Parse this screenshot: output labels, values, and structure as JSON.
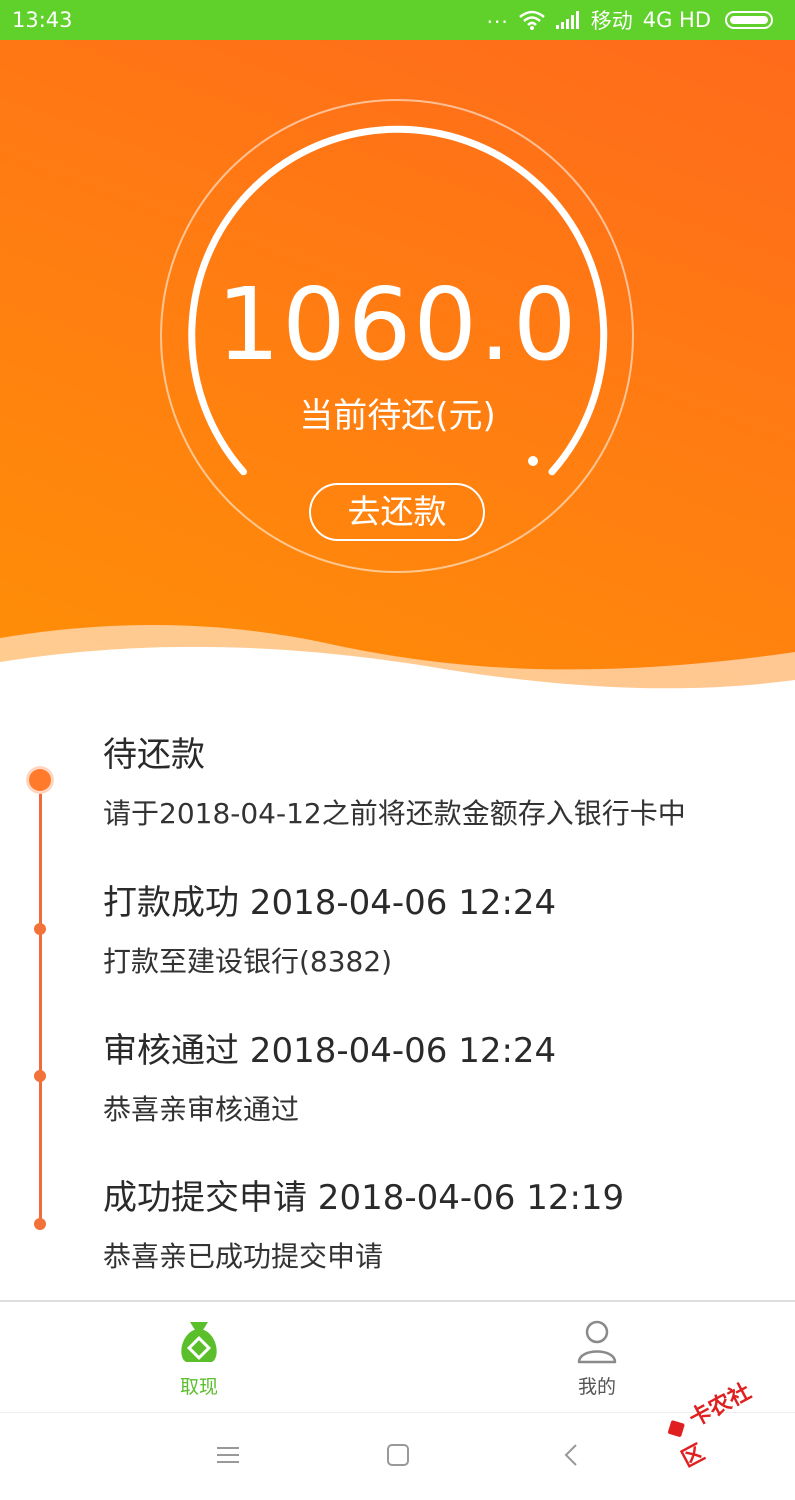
{
  "status_bar": {
    "time": "13:43",
    "dots": "...",
    "carrier": "移动",
    "network": "4G HD",
    "icons": [
      "wifi-icon",
      "signal-icon",
      "battery-icon"
    ]
  },
  "hero": {
    "amount": "1060.0",
    "amount_label": "当前待还(元)",
    "repay_button": "去还款"
  },
  "timeline": [
    {
      "title": "待还款",
      "desc": "请于2018-04-12之前将还款金额存入银行卡中"
    },
    {
      "title": "打款成功 2018-04-06 12:24",
      "desc": "打款至建设银行(8382)"
    },
    {
      "title": "审核通过 2018-04-06 12:24",
      "desc": "恭喜亲审核通过"
    },
    {
      "title": "成功提交申请 2018-04-06 12:19",
      "desc": "恭喜亲已成功提交申请"
    }
  ],
  "tabs": [
    {
      "label": "取现",
      "icon": "money-bag-icon"
    },
    {
      "label": "我的",
      "icon": "user-icon"
    }
  ],
  "watermark": "卡农社区",
  "colors": {
    "status_bar": "#5fd12a",
    "hero_start": "#ff6a1b",
    "hero_end": "#ff8f07",
    "timeline_accent": "#f2693b",
    "tab_active": "#5bbf2c"
  }
}
